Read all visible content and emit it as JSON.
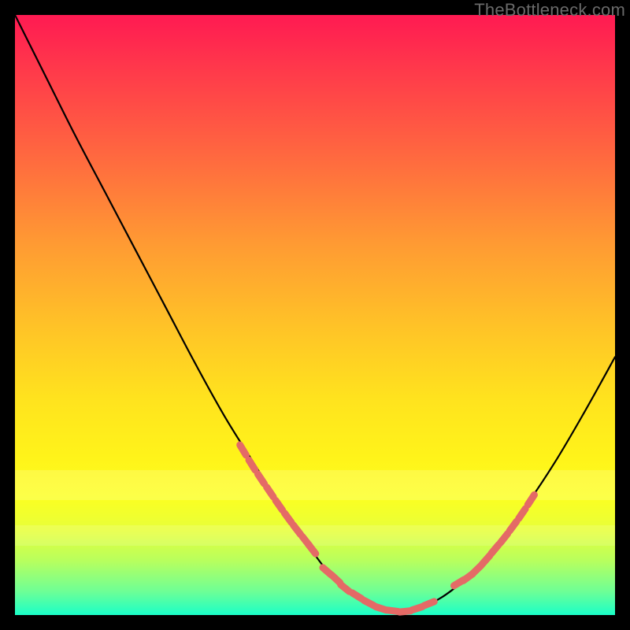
{
  "watermark": "TheBottleneck.com",
  "colors": {
    "curve_stroke": "#000000",
    "marker_fill": "#e46a66",
    "gradient_top": "#ff1a52",
    "gradient_bottom": "#1affc8",
    "page_bg": "#000000"
  },
  "chart_data": {
    "type": "line",
    "title": "",
    "xlabel": "",
    "ylabel": "",
    "xlim": [
      0,
      100
    ],
    "ylim": [
      0,
      100
    ],
    "grid": false,
    "legend": false,
    "series": [
      {
        "name": "bottleneck-curve",
        "x": [
          0,
          5,
          10,
          15,
          20,
          25,
          30,
          35,
          40,
          45,
          50,
          52,
          55,
          58,
          60,
          62,
          65,
          70,
          75,
          80,
          85,
          90,
          95,
          100
        ],
        "values": [
          100,
          90,
          80,
          70.5,
          61,
          51.5,
          42,
          33,
          25,
          17,
          10,
          7.5,
          4.5,
          2.5,
          1.3,
          0.7,
          0.6,
          2.3,
          6,
          11.5,
          18,
          25.5,
          34,
          43
        ]
      }
    ],
    "markers_left": {
      "name": "marker-cluster-left",
      "x": [
        38,
        39.5,
        41,
        42.5,
        44,
        45.5,
        47,
        48.5,
        49.5
      ],
      "values": [
        27.5,
        25,
        22.7,
        20.5,
        18.3,
        16.2,
        14.2,
        12.3,
        11
      ]
    },
    "markers_bottom": {
      "name": "marker-cluster-bottom",
      "x": [
        52,
        53.5,
        55,
        57,
        59,
        61,
        63,
        65,
        67,
        69
      ],
      "values": [
        7.3,
        6,
        4.5,
        3.2,
        2,
        1.1,
        0.7,
        0.6,
        1.1,
        1.9
      ]
    },
    "markers_right": {
      "name": "marker-cluster-right",
      "x": [
        74,
        75.5,
        77,
        78.5,
        80,
        81.5,
        83,
        84.5,
        86
      ],
      "values": [
        5.4,
        6.3,
        7.6,
        9.2,
        11,
        12.8,
        14.8,
        16.9,
        19.2
      ]
    }
  }
}
